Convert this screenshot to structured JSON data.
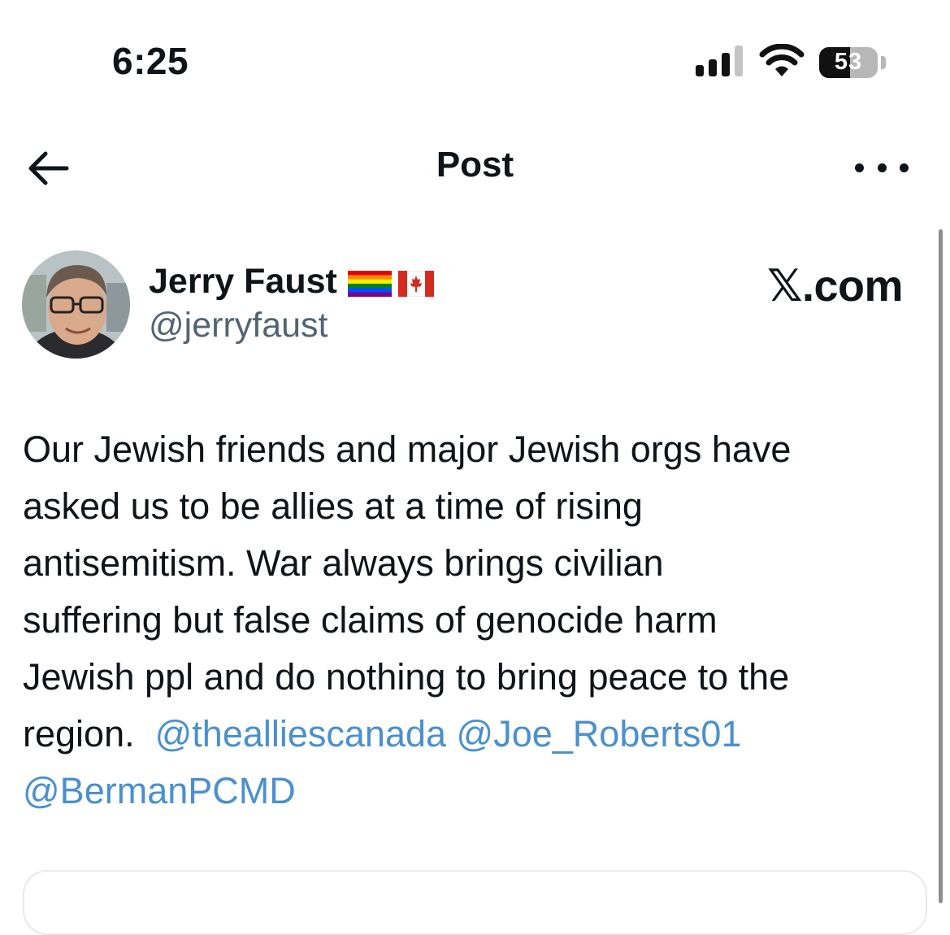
{
  "status_bar": {
    "time": "6:25",
    "battery": "53"
  },
  "header": {
    "title": "Post"
  },
  "author": {
    "name": "Jerry Faust",
    "handle": "@jerryfaust",
    "flags": [
      "rainbow-flag-icon",
      "canada-flag-icon"
    ]
  },
  "brand": {
    "label": "𝕏.com"
  },
  "post": {
    "lines": [
      "Our Jewish friends and major Jewish orgs have",
      "asked us to be allies at a time of rising",
      "antisemitism.  War always brings civilian",
      "suffering but false claims of genocide harm",
      "Jewish ppl and do nothing to bring peace to the"
    ],
    "last_line_text": "region.  ",
    "mentions": [
      "@thealliescanada",
      "@Joe_Roberts01",
      "@BermanPCMD"
    ]
  },
  "colors": {
    "text": "#0f1419",
    "secondary": "#536471",
    "mention": "#4a90cf"
  }
}
